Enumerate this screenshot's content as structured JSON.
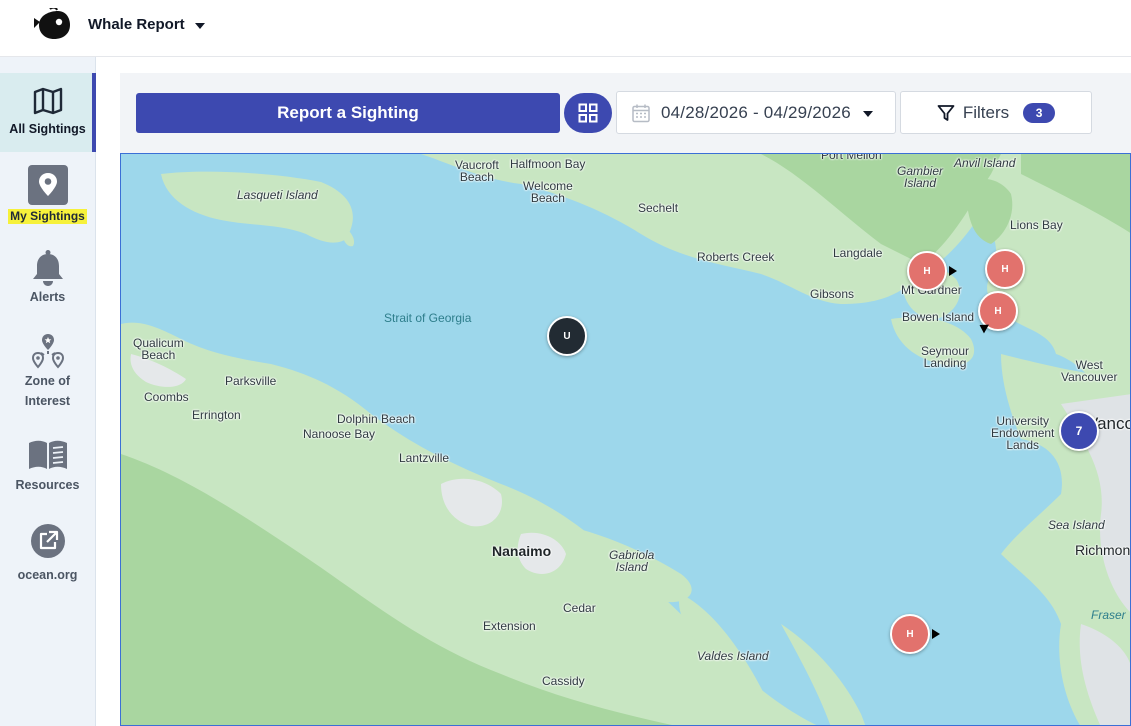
{
  "header": {
    "app_title": "Whale Report",
    "logo_icon": "whale-logo-icon"
  },
  "sidebar": {
    "items": [
      {
        "label": "All Sightings",
        "icon": "map-icon",
        "active": true
      },
      {
        "label": "My Sightings",
        "icon": "location-pin-icon",
        "highlighted": true
      },
      {
        "label": "Alerts",
        "icon": "bell-icon"
      },
      {
        "label": "Zone of\nInterest",
        "icon": "zone-pins-icon"
      },
      {
        "label": "Resources",
        "icon": "book-icon"
      },
      {
        "label": "ocean.org",
        "icon": "external-link-icon"
      }
    ]
  },
  "toolbar": {
    "report_label": "Report a Sighting",
    "date_range": "04/28/2026 - 04/29/2026",
    "filters_label": "Filters",
    "filters_count": "3"
  },
  "map": {
    "places": [
      {
        "name": "Vaucroft\nBeach"
      },
      {
        "name": "Halfmoon Bay"
      },
      {
        "name": "Welcome\nBeach"
      },
      {
        "name": "Port Mellon"
      },
      {
        "name": "Gambier\nIsland"
      },
      {
        "name": "Anvil Island"
      },
      {
        "name": "Lasqueti Island"
      },
      {
        "name": "Sechelt"
      },
      {
        "name": "Lions Bay"
      },
      {
        "name": "Langdale"
      },
      {
        "name": "Roberts Creek"
      },
      {
        "name": "Gibsons"
      },
      {
        "name": "Mt Gardner"
      },
      {
        "name": "Bowen Island"
      },
      {
        "name": "Seymour\nLanding"
      },
      {
        "name": "Strait of Georgia"
      },
      {
        "name": "Qualicum\nBeach"
      },
      {
        "name": "Parksville"
      },
      {
        "name": "Coombs"
      },
      {
        "name": "Errington"
      },
      {
        "name": "Dolphin Beach"
      },
      {
        "name": "Nanoose Bay"
      },
      {
        "name": "Lantzville"
      },
      {
        "name": "West\nVancouver"
      },
      {
        "name": "University\nEndowment\nLands"
      },
      {
        "name": "Vancou"
      },
      {
        "name": "Sea Island"
      },
      {
        "name": "Richmon"
      },
      {
        "name": "Nanaimo"
      },
      {
        "name": "Gabriola\nIsland"
      },
      {
        "name": "Cedar"
      },
      {
        "name": "Extension"
      },
      {
        "name": "Valdes Island"
      },
      {
        "name": "Cassidy"
      },
      {
        "name": "Fraser"
      }
    ],
    "markers": [
      {
        "label": "H",
        "type": "humpback"
      },
      {
        "label": "H",
        "type": "humpback"
      },
      {
        "label": "H",
        "type": "humpback"
      },
      {
        "label": "U",
        "type": "unknown"
      },
      {
        "label": "7",
        "type": "cluster"
      },
      {
        "label": "H",
        "type": "humpback"
      }
    ]
  }
}
